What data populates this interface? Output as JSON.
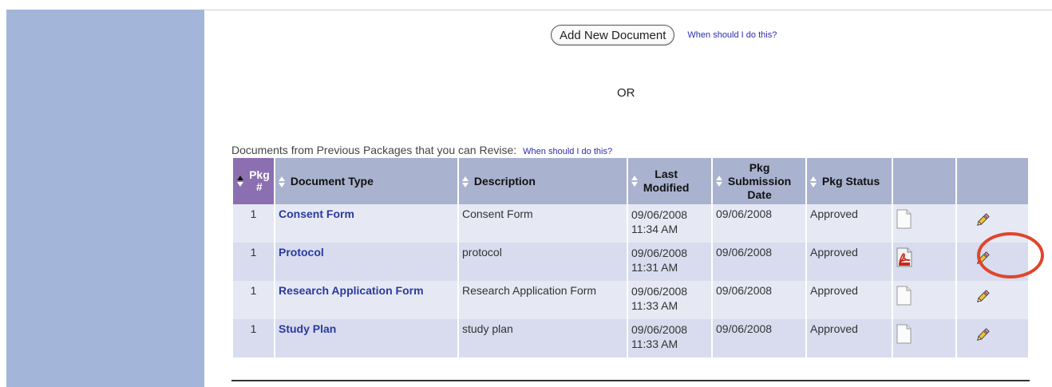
{
  "actions": {
    "add_new_document_label": "Add New Document",
    "help_link_label": "When should I do this?",
    "or_label": "OR"
  },
  "previous_docs": {
    "heading": "Documents from Previous Packages that you can Revise:",
    "help_link_label": "When should I do this?"
  },
  "table": {
    "headers": {
      "pkg_line1": "Pkg",
      "pkg_line2": "#",
      "document_type": "Document Type",
      "description": "Description",
      "last_modified_line1": "Last",
      "last_modified_line2": "Modified",
      "pkg_sub_line1": "Pkg",
      "pkg_sub_line2": "Submission",
      "pkg_sub_line3": "Date",
      "pkg_status": "Pkg Status"
    },
    "rows": [
      {
        "pkg": "1",
        "doc_type": "Consent Form",
        "description": "Consent Form",
        "mod_date": "09/06/2008",
        "mod_time": "11:34 AM",
        "submitted": "09/06/2008",
        "status": "Approved",
        "file_icon": "document-icon"
      },
      {
        "pkg": "1",
        "doc_type": "Protocol",
        "description": "protocol",
        "mod_date": "09/06/2008",
        "mod_time": "11:31 AM",
        "submitted": "09/06/2008",
        "status": "Approved",
        "file_icon": "pdf-icon"
      },
      {
        "pkg": "1",
        "doc_type": "Research Application Form",
        "description": "Research Application Form",
        "mod_date": "09/06/2008",
        "mod_time": "11:33 AM",
        "submitted": "09/06/2008",
        "status": "Approved",
        "file_icon": "document-icon"
      },
      {
        "pkg": "1",
        "doc_type": "Study Plan",
        "description": "study plan",
        "mod_date": "09/06/2008",
        "mod_time": "11:33 AM",
        "submitted": "09/06/2008",
        "status": "Approved",
        "file_icon": "document-icon"
      }
    ],
    "highlighted_row": 1
  },
  "colors": {
    "sidebar": "#a3b6d9",
    "header_bg": "#a9b2cf",
    "pkg_header_bg": "#8c6fb0",
    "row_odd": "#e6e9f4",
    "row_even": "#d8dcee",
    "link": "#2a3a9e",
    "highlight_ring": "#e0452b"
  }
}
